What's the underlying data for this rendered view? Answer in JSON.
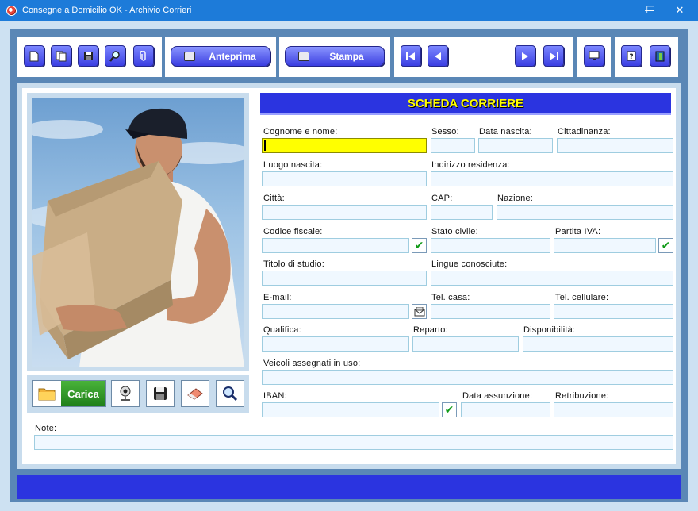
{
  "window": {
    "title": "Consegne a Domicilio OK - Archivio Corrieri",
    "minimize": "—",
    "maximize": "☐",
    "close": "✕"
  },
  "toolbar": {
    "file_icons": [
      "new-icon",
      "copy-icon",
      "save-icon",
      "search-icon",
      "attach-icon"
    ],
    "preview_label": "Anteprima",
    "print_label": "Stampa",
    "nav_icons": [
      "first-icon",
      "previous-icon",
      "next-icon",
      "last-icon"
    ],
    "extra_icons": [
      "monitor-icon",
      "help-icon",
      "exit-icon"
    ]
  },
  "form": {
    "header": "SCHEDA CORRIERE",
    "labels": {
      "cognome": "Cognome e nome:",
      "sesso": "Sesso:",
      "data_nascita": "Data nascita:",
      "cittadinanza": "Cittadinanza:",
      "luogo_nascita": "Luogo nascita:",
      "indirizzo": "Indirizzo residenza:",
      "citta": "Città:",
      "cap": "CAP:",
      "nazione": "Nazione:",
      "codice_fiscale": "Codice fiscale:",
      "stato_civile": "Stato civile:",
      "partita_iva": "Partita IVA:",
      "titolo_studio": "Titolo di studio:",
      "lingue": "Lingue conosciute:",
      "email": "E-mail:",
      "tel_casa": "Tel. casa:",
      "tel_cellulare": "Tel. cellulare:",
      "qualifica": "Qualifica:",
      "reparto": "Reparto:",
      "disponibilita": "Disponibilità:",
      "veicoli": "Veicoli assegnati in uso:",
      "iban": "IBAN:",
      "data_assunzione": "Data assunzione:",
      "retribuzione": "Retribuzione:",
      "note": "Note:"
    },
    "check_mark": "✔"
  },
  "photo_tools": {
    "load_label": "Carica",
    "icons": [
      "folder-icon",
      "webcam-icon",
      "save-photo-icon",
      "eraser-icon",
      "zoom-icon"
    ]
  },
  "colors": {
    "accent": "#2b34e0",
    "header_text": "#ffff00",
    "title_bar": "#1d7bd9",
    "active_field": "#ffff00",
    "carica_green": "#2e9a25"
  }
}
